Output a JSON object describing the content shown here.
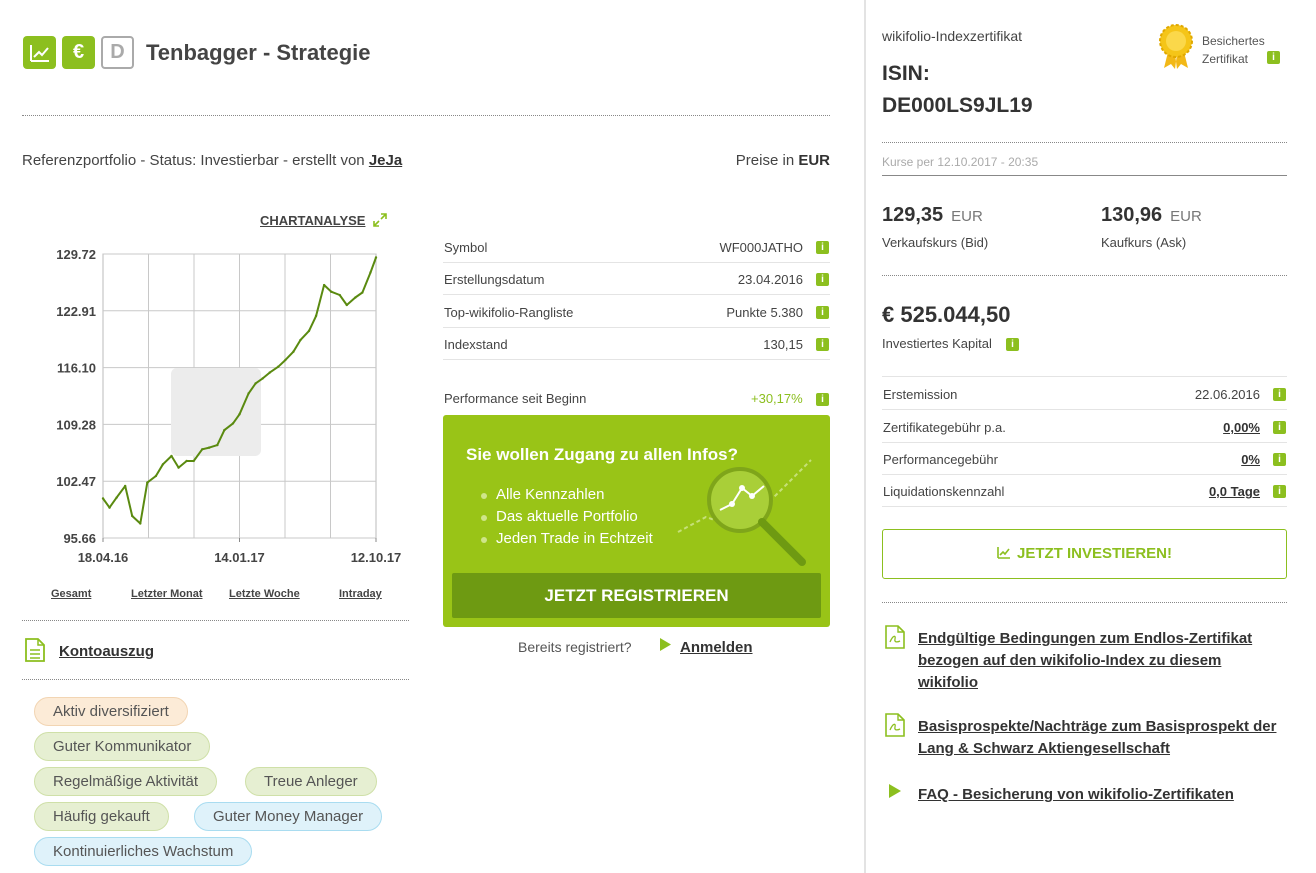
{
  "header": {
    "icons": [
      "chart-trend-icon",
      "euro-icon",
      "d-badge-icon"
    ],
    "d_badge": "D",
    "euro_glyph": "€",
    "title": "Tenbagger - Strategie"
  },
  "reference": {
    "prefix": "Referenzportfolio - Status: Investierbar - erstellt von ",
    "author": "JeJa",
    "prices_prefix": "Preise in ",
    "currency": "EUR"
  },
  "chart": {
    "link_label": "CHARTANALYSE",
    "tabs": [
      "Gesamt",
      "Letzter Monat",
      "Letzte Woche",
      "Intraday"
    ]
  },
  "chart_data": {
    "type": "line",
    "title": "",
    "xlabel": "",
    "ylabel": "",
    "x_ticks": [
      "18.04.16",
      "14.01.17",
      "12.10.17"
    ],
    "y_ticks": [
      "129.72",
      "122.91",
      "116.10",
      "109.28",
      "102.47",
      "95.66"
    ],
    "ylim": [
      95.66,
      129.72
    ],
    "grid": true,
    "series": [
      {
        "color": "#5a8a10",
        "x": [
          "18.04.16",
          "01.05.16",
          "15.05.16",
          "01.06.16",
          "15.06.16",
          "01.07.16",
          "15.07.16",
          "01.08.16",
          "15.08.16",
          "01.09.16",
          "15.09.16",
          "01.10.16",
          "15.10.16",
          "01.11.16",
          "15.11.16",
          "01.12.16",
          "15.12.16",
          "01.01.17",
          "14.01.17",
          "01.02.17",
          "15.02.17",
          "01.03.17",
          "15.03.17",
          "01.04.17",
          "15.04.17",
          "01.05.17",
          "15.05.17",
          "01.06.17",
          "15.06.17",
          "01.07.17",
          "15.07.17",
          "01.08.17",
          "15.08.17",
          "01.09.17",
          "15.09.17",
          "01.10.17",
          "12.10.17"
        ],
        "values": [
          100.4,
          99.3,
          100.5,
          101.9,
          98.3,
          97.4,
          102.3,
          103.1,
          104.5,
          105.5,
          104.1,
          104.9,
          104.9,
          106.3,
          106.5,
          106.8,
          108.6,
          109.4,
          110.5,
          113.0,
          114.2,
          114.8,
          115.5,
          116.2,
          117.0,
          118.0,
          119.4,
          120.5,
          122.3,
          126.0,
          125.2,
          124.8,
          123.6,
          124.5,
          125.1,
          127.5,
          129.3
        ]
      }
    ]
  },
  "key_figures": [
    {
      "label": "Symbol",
      "value": "WF000JATHO"
    },
    {
      "label": "Erstellungsdatum",
      "value": "23.04.2016"
    },
    {
      "label": "Top-wikifolio-Rangliste",
      "value": "Punkte 5.380"
    },
    {
      "label": "Indexstand",
      "value": "130,15"
    }
  ],
  "performance": {
    "label": "Performance seit Beginn",
    "value": "+30,17%"
  },
  "info_glyph": "i",
  "promo": {
    "title": "Sie wollen Zugang zu allen Infos?",
    "items": [
      "Alle Kennzahlen",
      "Das aktuelle Portfolio",
      "Jeden Trade in Echtzeit"
    ],
    "button": "JETZT REGISTRIEREN",
    "already": "Bereits registriert?",
    "login": "Anmelden"
  },
  "account": {
    "label": "Kontoauszug"
  },
  "tags": [
    {
      "label": "Aktiv diversifiziert",
      "style": "orange"
    },
    {
      "label": "Guter Kommunikator",
      "style": "green"
    },
    {
      "label": "Regelmäßige Aktivität",
      "style": "green"
    },
    {
      "label": "Treue Anleger",
      "style": "green"
    },
    {
      "label": "Häufig gekauft",
      "style": "green"
    },
    {
      "label": "Guter Money Manager",
      "style": "blue"
    },
    {
      "label": "Kontinuierliches Wachstum",
      "style": "blue"
    }
  ],
  "certificate": {
    "index_label": "wikifolio-Indexzertifikat",
    "isin_label": "ISIN:",
    "isin": "DE000LS9JL19",
    "secured_line1": "Besichertes",
    "secured_line2": "Zertifikat",
    "quote_time": "Kurse per 12.10.2017 - 20:35",
    "bid": {
      "value": "129,35",
      "currency": "EUR",
      "label": "Verkaufskurs (Bid)"
    },
    "ask": {
      "value": "130,96",
      "currency": "EUR",
      "label": "Kaufkurs (Ask)"
    },
    "capital": {
      "value": "€ 525.044,50",
      "label": "Investiertes Kapital"
    },
    "rows": [
      {
        "label": "Erstemission",
        "value": "22.06.2016",
        "underline": false
      },
      {
        "label": "Zertifikategebühr p.a.",
        "value": "0,00%",
        "underline": true
      },
      {
        "label": "Performancegebühr",
        "value": "0%",
        "underline": true
      },
      {
        "label": "Liquidationskennzahl",
        "value": "0,0 Tage",
        "underline": true
      }
    ],
    "invest_button": "JETZT INVESTIEREN!"
  },
  "documents": [
    {
      "line1": "Endgültige Bedingungen zum Endlos-Zertifikat",
      "line2": "bezogen auf den wikifolio-Index zu diesem",
      "line3": "wikifolio",
      "icon": "pdf-icon"
    },
    {
      "line1": "Basisprospekte/Nachträge zum Basisprospekt der",
      "line2": "Lang & Schwarz Aktiengesellschaft",
      "icon": "pdf-icon"
    },
    {
      "line1": "FAQ - Besicherung von wikifolio-Zertifikaten",
      "icon": "play-icon"
    }
  ]
}
